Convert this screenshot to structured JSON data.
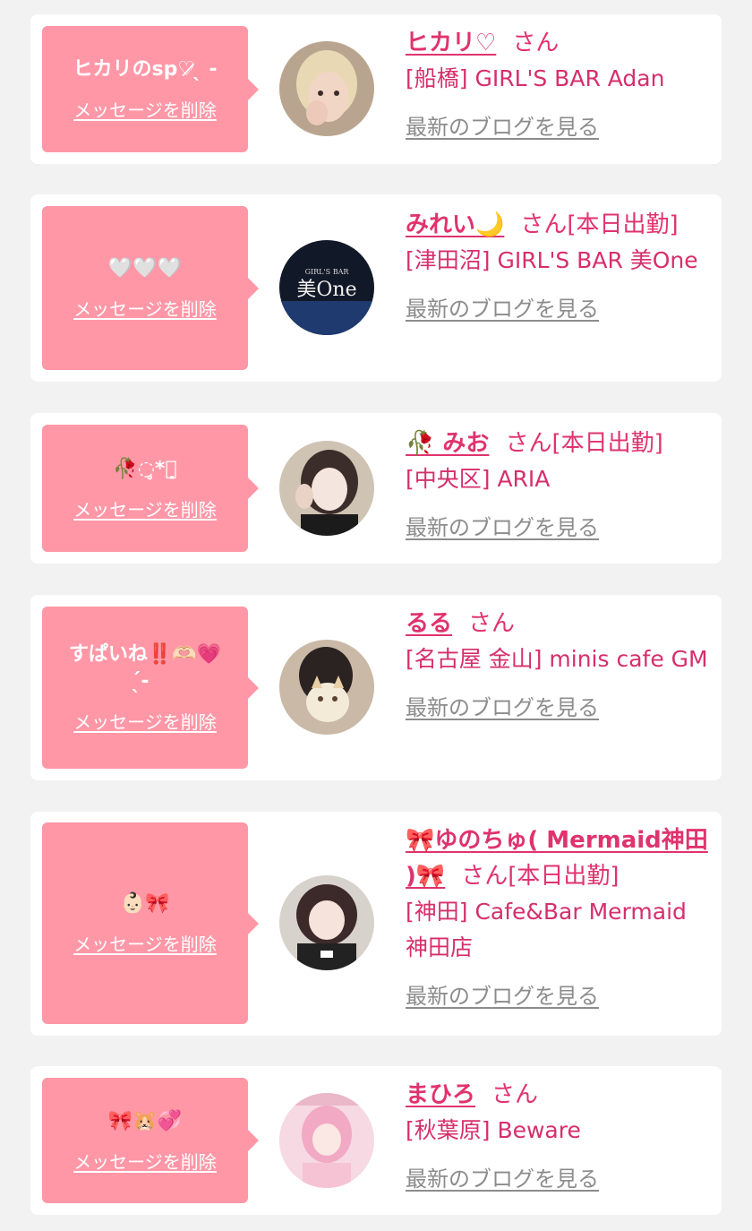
{
  "colors": {
    "accent": "#e0336e",
    "bubble": "#ff97a7",
    "link_gray": "#8c8c8c",
    "background": "#f2f2f2"
  },
  "delete_label": "メッセージを削除",
  "blog_label": "最新のブログを見る",
  "san_label": "さん",
  "entries": [
    {
      "message": "ヒカリのsp♡̷̷ ̖ -",
      "name": "ヒカリ♡",
      "work_status": "",
      "shop": "[船橋] GIRL'S BAR Adan"
    },
    {
      "message": "🤍🤍🤍",
      "name": "みれい🌙",
      "work_status": "[本日出勤]",
      "shop": "[津田沼] GIRL'S BAR 美One"
    },
    {
      "message": "🥀◌̥*⃝̣",
      "name": "🥀 みお",
      "work_status": "[本日出勤]",
      "shop": "[中央区] ARIA"
    },
    {
      "message": "すぱいね‼️🫶🏻💗\n ̖́-",
      "name": "るる",
      "work_status": "",
      "shop": "[名古屋 金山] minis cafe GM"
    },
    {
      "message": "👶🏻🎀",
      "name": "🎀ゆのちゅ( Mermaid神田 )🎀",
      "work_status": "[本日出勤]",
      "shop": "[神田] Cafe&Bar Mermaid 神田店"
    },
    {
      "message": "🎀🐹💞",
      "name": "まひろ",
      "work_status": "",
      "shop": "[秋葉原] Beware"
    }
  ]
}
